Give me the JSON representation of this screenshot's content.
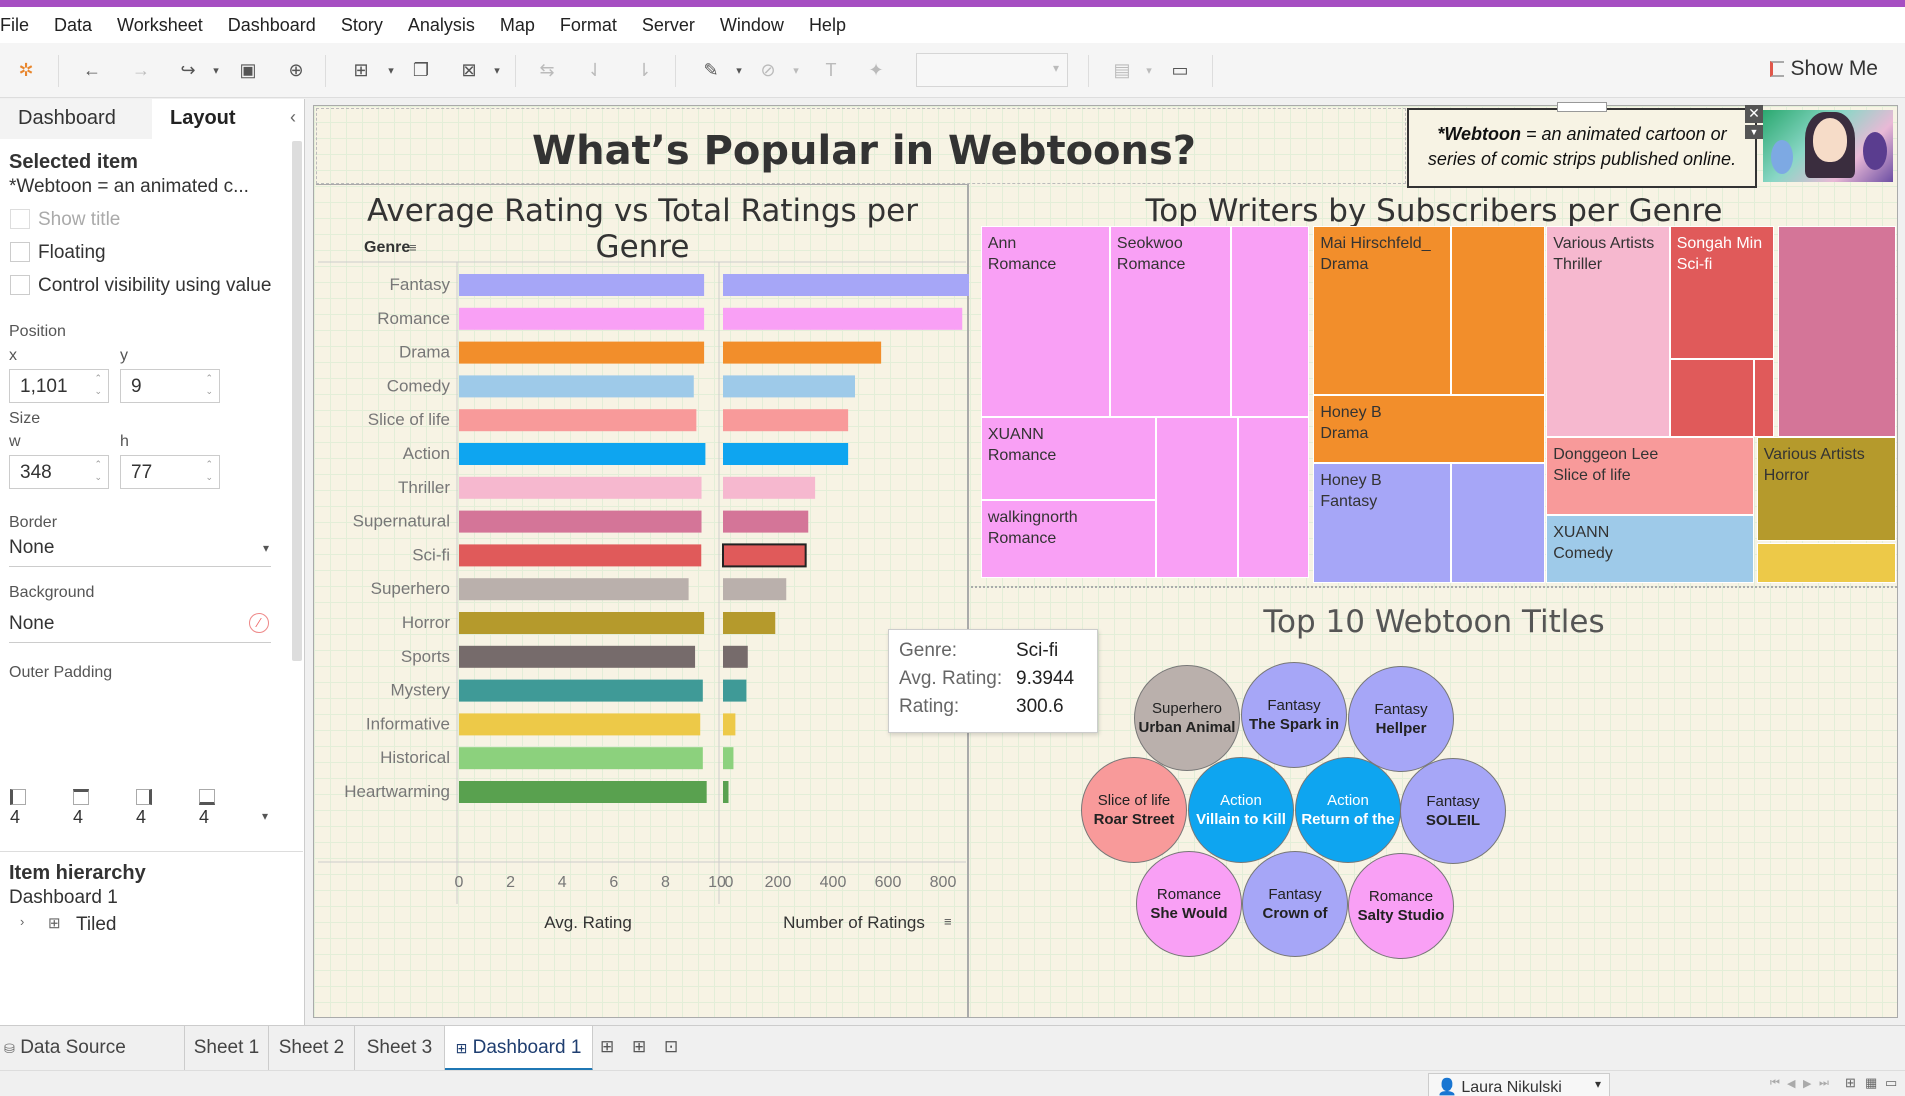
{
  "menu": [
    "File",
    "Data",
    "Worksheet",
    "Dashboard",
    "Story",
    "Analysis",
    "Map",
    "Format",
    "Server",
    "Window",
    "Help"
  ],
  "toolbar": {
    "show_me": "Show Me"
  },
  "left_panel": {
    "tabs": [
      "Dashboard",
      "Layout"
    ],
    "selected_item_title": "Selected item",
    "selected_item_value": "*Webtoon = an animated c...",
    "show_title": "Show title",
    "floating": "Floating",
    "control_visibility": "Control visibility using value",
    "position_label": "Position",
    "x_label": "x",
    "y_label": "y",
    "x_value": "1,101",
    "y_value": "9",
    "size_label": "Size",
    "w_label": "w",
    "h_label": "h",
    "w_value": "348",
    "h_value": "77",
    "border_label": "Border",
    "border_value": "None",
    "background_label": "Background",
    "background_value": "None",
    "outer_padding_label": "Outer Padding",
    "padding_values": [
      "4",
      "4",
      "4",
      "4"
    ],
    "item_hierarchy_title": "Item hierarchy",
    "hierarchy_root": "Dashboard 1",
    "hierarchy_child": "Tiled"
  },
  "dashboard": {
    "title": "What’s Popular in Webtoons?",
    "definition_bold": "*Webtoon",
    "definition_rest": " = an animated cartoon or series of comic strips published online."
  },
  "tooltip": {
    "genre_label": "Genre:",
    "genre_value": "Sci-fi",
    "avg_label": "Avg. Rating:",
    "avg_value": "9.3944",
    "rating_label": "Rating:",
    "rating_value": "300.6"
  },
  "chart_data": [
    {
      "type": "bar",
      "title": "Average Rating vs Total Ratings per Genre",
      "row_header": "Genre",
      "categories": [
        "Fantasy",
        "Romance",
        "Drama",
        "Comedy",
        "Slice of life",
        "Action",
        "Thriller",
        "Supernatural",
        "Sci-fi",
        "Superhero",
        "Horror",
        "Sports",
        "Mystery",
        "Informative",
        "Historical",
        "Heartwarming"
      ],
      "colors": [
        "#a6a6f7",
        "#f9a0f5",
        "#f28e2b",
        "#9ecae9",
        "#f89a9a",
        "#0ea5f0",
        "#f6b8cf",
        "#d47598",
        "#e05a5a",
        "#bab0ac",
        "#b59a2c",
        "#766b6b",
        "#3f9a97",
        "#edc948",
        "#8cd17d",
        "#59a14f"
      ],
      "series": [
        {
          "name": "Avg. Rating",
          "values": [
            9.5,
            9.5,
            9.5,
            9.1,
            9.2,
            9.55,
            9.4,
            9.4,
            9.39,
            8.9,
            9.5,
            9.15,
            9.45,
            9.35,
            9.45,
            9.6
          ],
          "xlim": [
            0,
            10
          ],
          "ticks": [
            "0",
            "2",
            "4",
            "6",
            "8",
            "10"
          ],
          "xlabel": "Avg. Rating"
        },
        {
          "name": "Number of Ratings",
          "values": [
            915,
            870,
            575,
            480,
            455,
            455,
            335,
            310,
            300.6,
            230,
            190,
            90,
            85,
            45,
            38,
            20
          ],
          "xlim": [
            0,
            920
          ],
          "ticks": [
            "0",
            "200",
            "400",
            "600",
            "800"
          ],
          "tick_values": [
            0,
            200,
            400,
            600,
            800
          ],
          "xlabel": "Number of Ratings"
        }
      ]
    },
    {
      "type": "treemap",
      "title": "Top Writers by Subscribers per Genre",
      "cells": [
        {
          "writer": "Ann",
          "genre": "Romance",
          "color": "#f9a0f5"
        },
        {
          "writer": "Seokwoo",
          "genre": "Romance",
          "color": "#f9a0f5"
        },
        {
          "writer": "",
          "genre": "",
          "color": "#f9a0f5"
        },
        {
          "writer": "XUANN",
          "genre": "Romance",
          "color": "#f9a0f5"
        },
        {
          "writer": "",
          "genre": "",
          "color": "#f9a0f5"
        },
        {
          "writer": "",
          "genre": "",
          "color": "#f9a0f5"
        },
        {
          "writer": "",
          "genre": "",
          "color": "#f9a0f5"
        },
        {
          "writer": "walkingnorth",
          "genre": "Romance",
          "color": "#f9a0f5"
        },
        {
          "writer": "Mai Hirschfeld_",
          "genre": "Drama",
          "color": "#f28e2b"
        },
        {
          "writer": "",
          "genre": "",
          "color": "#f28e2b"
        },
        {
          "writer": "Honey B",
          "genre": "Drama",
          "color": "#f28e2b"
        },
        {
          "writer": "Honey B",
          "genre": "Fantasy",
          "color": "#a6a6f7"
        },
        {
          "writer": "",
          "genre": "",
          "color": "#a6a6f7"
        },
        {
          "writer": "Various Artists",
          "genre": "Thriller",
          "color": "#f6b8cf"
        },
        {
          "writer": "Songah Min",
          "genre": "Sci-fi",
          "color": "#e05a5a"
        },
        {
          "writer": "",
          "genre": "",
          "color": "#e05a5a"
        },
        {
          "writer": "",
          "genre": "",
          "color": "#e05a5a"
        },
        {
          "writer": "",
          "genre": "",
          "color": "#d47598"
        },
        {
          "writer": "Donggeon Lee",
          "genre": "Slice of life",
          "color": "#f89a9a"
        },
        {
          "writer": "Various Artists",
          "genre": "Horror",
          "color": "#b59a2c"
        },
        {
          "writer": "XUANN",
          "genre": "Comedy",
          "color": "#9ecae9"
        },
        {
          "writer": "",
          "genre": "",
          "color": "#edc948"
        }
      ]
    },
    {
      "type": "bubble",
      "title": "Top 10 Webtoon Titles",
      "bubbles": [
        {
          "genre": "Superhero",
          "title": "Urban Animal",
          "color": "#bab0ac"
        },
        {
          "genre": "Fantasy",
          "title": "The Spark in",
          "color": "#a6a6f7"
        },
        {
          "genre": "Fantasy",
          "title": "Hellper",
          "color": "#a6a6f7"
        },
        {
          "genre": "Slice of life",
          "title": "Roar Street",
          "color": "#f89a9a"
        },
        {
          "genre": "Action",
          "title": "Villain to Kill",
          "color": "#0ea5f0"
        },
        {
          "genre": "Action",
          "title": "Return of the",
          "color": "#0ea5f0"
        },
        {
          "genre": "Fantasy",
          "title": "SOLEIL",
          "color": "#a6a6f7"
        },
        {
          "genre": "Romance",
          "title": "She Would",
          "color": "#f9a0f5"
        },
        {
          "genre": "Fantasy",
          "title": "Crown of",
          "color": "#a6a6f7"
        },
        {
          "genre": "Romance",
          "title": "Salty Studio",
          "color": "#f9a0f5"
        }
      ]
    }
  ],
  "sheet_tabs": [
    "Data Source",
    "Sheet 1",
    "Sheet 2",
    "Sheet 3",
    "Dashboard 1"
  ],
  "status": {
    "user": "Laura Nikulski"
  }
}
